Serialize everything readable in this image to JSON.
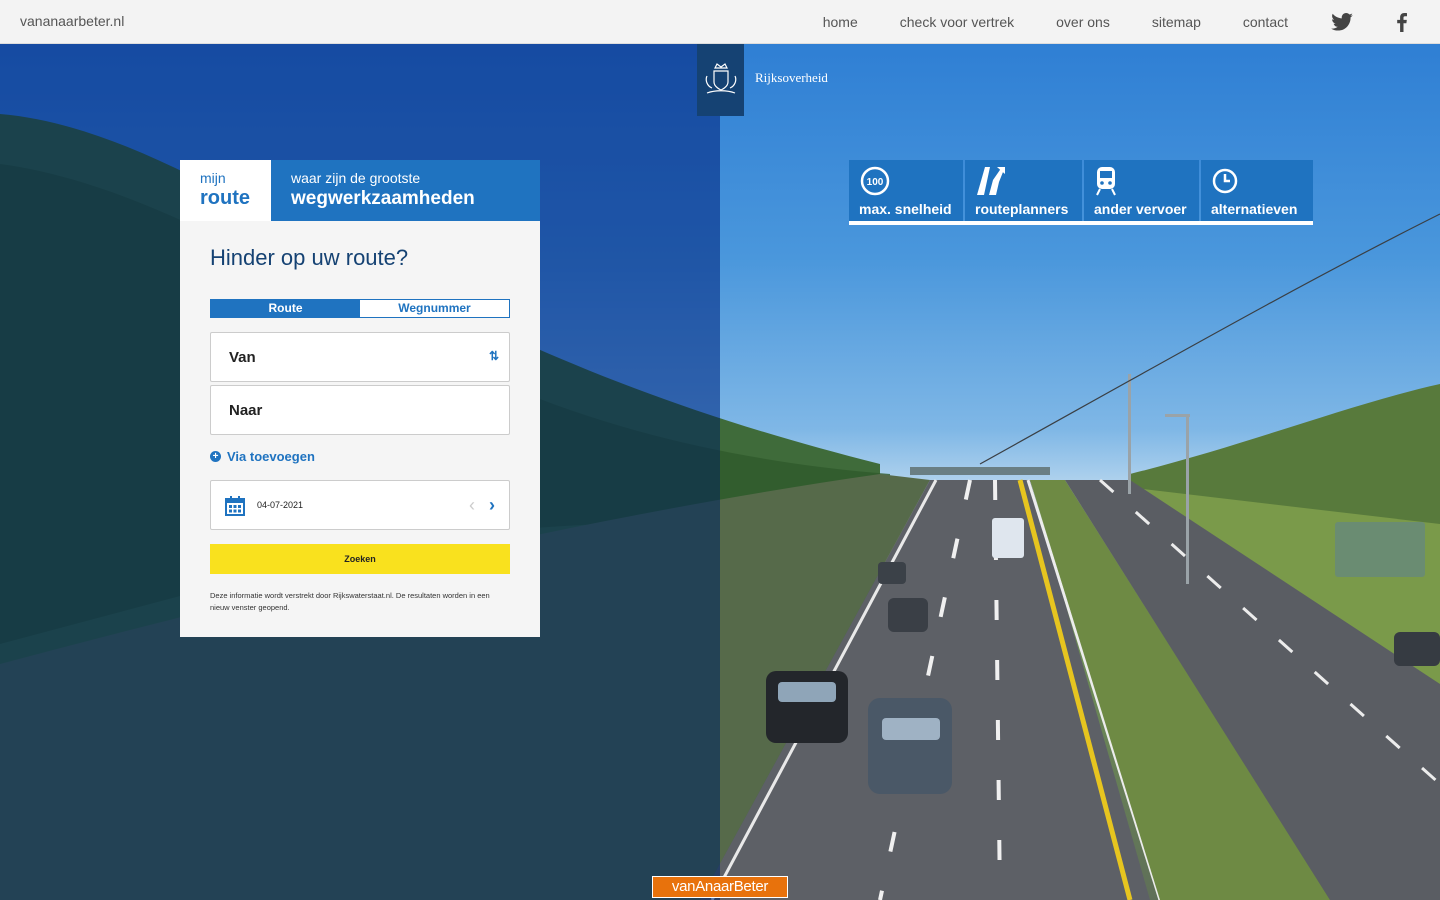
{
  "site": {
    "name": "vananaarbeter.nl"
  },
  "nav": {
    "items": [
      {
        "label": "home"
      },
      {
        "label": "check voor vertrek"
      },
      {
        "label": "over ons"
      },
      {
        "label": "sitemap"
      },
      {
        "label": "contact"
      }
    ],
    "social": [
      "twitter-icon",
      "facebook-icon"
    ]
  },
  "logo": {
    "text": "Rijksoverheid"
  },
  "panel": {
    "tab_mine": {
      "line1": "mijn",
      "line2": "route"
    },
    "tab_works": {
      "line1": "waar zijn de grootste",
      "line2": "wegwerkzaamheden"
    },
    "heading": "Hinder op uw route?",
    "toggle": {
      "route": "Route",
      "road_number": "Wegnummer",
      "active": "Route"
    },
    "from_label": "Van",
    "to_label": "Naar",
    "via_label": "Via toevoegen",
    "date_value": "04-07-2021",
    "search_label": "Zoeken",
    "note": "Deze informatie wordt verstrekt door Rijkswaterstaat.nl. De resultaten worden in een nieuw venster geopend."
  },
  "quick_links": {
    "speed": {
      "label": "max. snelheid",
      "icon_text": "100"
    },
    "planners": {
      "label": "routeplanners"
    },
    "transport": {
      "label": "ander vervoer"
    },
    "alternatives": {
      "label": "alternatieven"
    }
  },
  "badge": {
    "text": "vanAnaarBeter"
  },
  "colors": {
    "primary_blue": "#1f73c0",
    "dark_blue": "#154273",
    "yellow": "#f9e11e",
    "orange": "#e8720c"
  }
}
